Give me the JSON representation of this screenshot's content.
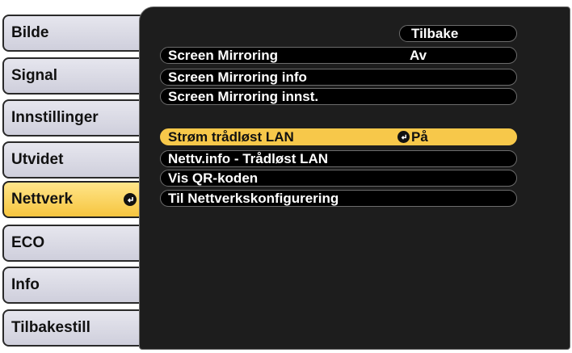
{
  "sidebar": {
    "items": [
      {
        "label": "Bilde"
      },
      {
        "label": "Signal"
      },
      {
        "label": "Innstillinger"
      },
      {
        "label": "Utvidet"
      },
      {
        "label": "Nettverk",
        "selected": true
      },
      {
        "label": "ECO"
      },
      {
        "label": "Info"
      },
      {
        "label": "Tilbakestill"
      }
    ]
  },
  "panel": {
    "back_label": "Tilbake",
    "rows": [
      {
        "label": "Screen Mirroring",
        "value": "Av"
      },
      {
        "label": "Screen Mirroring info",
        "value": ""
      },
      {
        "label": "Screen Mirroring innst.",
        "value": ""
      },
      {
        "label": "Strøm trådløst LAN",
        "value": "På",
        "selected": true
      },
      {
        "label": "Nettv.info - Trådløst LAN",
        "value": ""
      },
      {
        "label": "Vis QR-koden",
        "value": ""
      },
      {
        "label": "Til Nettverkskonfigurering",
        "value": ""
      }
    ]
  },
  "colors": {
    "selection": "#f7c84a",
    "panel_background": "#1d1d1d",
    "tab_background": "#d8d8e3"
  }
}
